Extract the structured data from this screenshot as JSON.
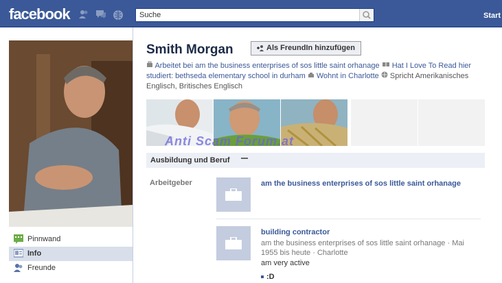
{
  "brand": {
    "logo": "facebook",
    "color": "#3b5998"
  },
  "header": {
    "search_placeholder": "Suche",
    "start_link": "Start",
    "icons": [
      "friends-icon",
      "messages-icon",
      "notifications-icon",
      "search-icon"
    ]
  },
  "profile": {
    "name": "Smith Morgan",
    "add_friend_label": "Als FreundIn hinzufügen",
    "info": {
      "work": "Arbeitet bei am the business enterprises of sos little saint orhanage",
      "quote": "Hat I Love To Read hier",
      "studied": "studiert: bethseda elementary school in durham",
      "lives": "Wohnt in Charlotte",
      "speaks": "Spricht Amerikanisches Englisch, Britisches Englisch"
    }
  },
  "watermark": "Anti Scam Forum.at",
  "nav": {
    "items": [
      {
        "label": "Pinnwand",
        "icon": "wall-icon"
      },
      {
        "label": "Info",
        "icon": "info-icon",
        "active": true
      },
      {
        "label": "Freunde",
        "icon": "friends-icon"
      }
    ]
  },
  "section": {
    "title": "Ausbildung und Beruf",
    "employer_label": "Arbeitgeber",
    "jobs": [
      {
        "title": "am the business enterprises of sos little saint orhanage"
      },
      {
        "title": "building contractor",
        "meta": "am the business enterprises of sos little saint orhanage · Mai 1955 bis heute · Charlotte",
        "description": "am very active",
        "bullet": ":D"
      }
    ]
  }
}
